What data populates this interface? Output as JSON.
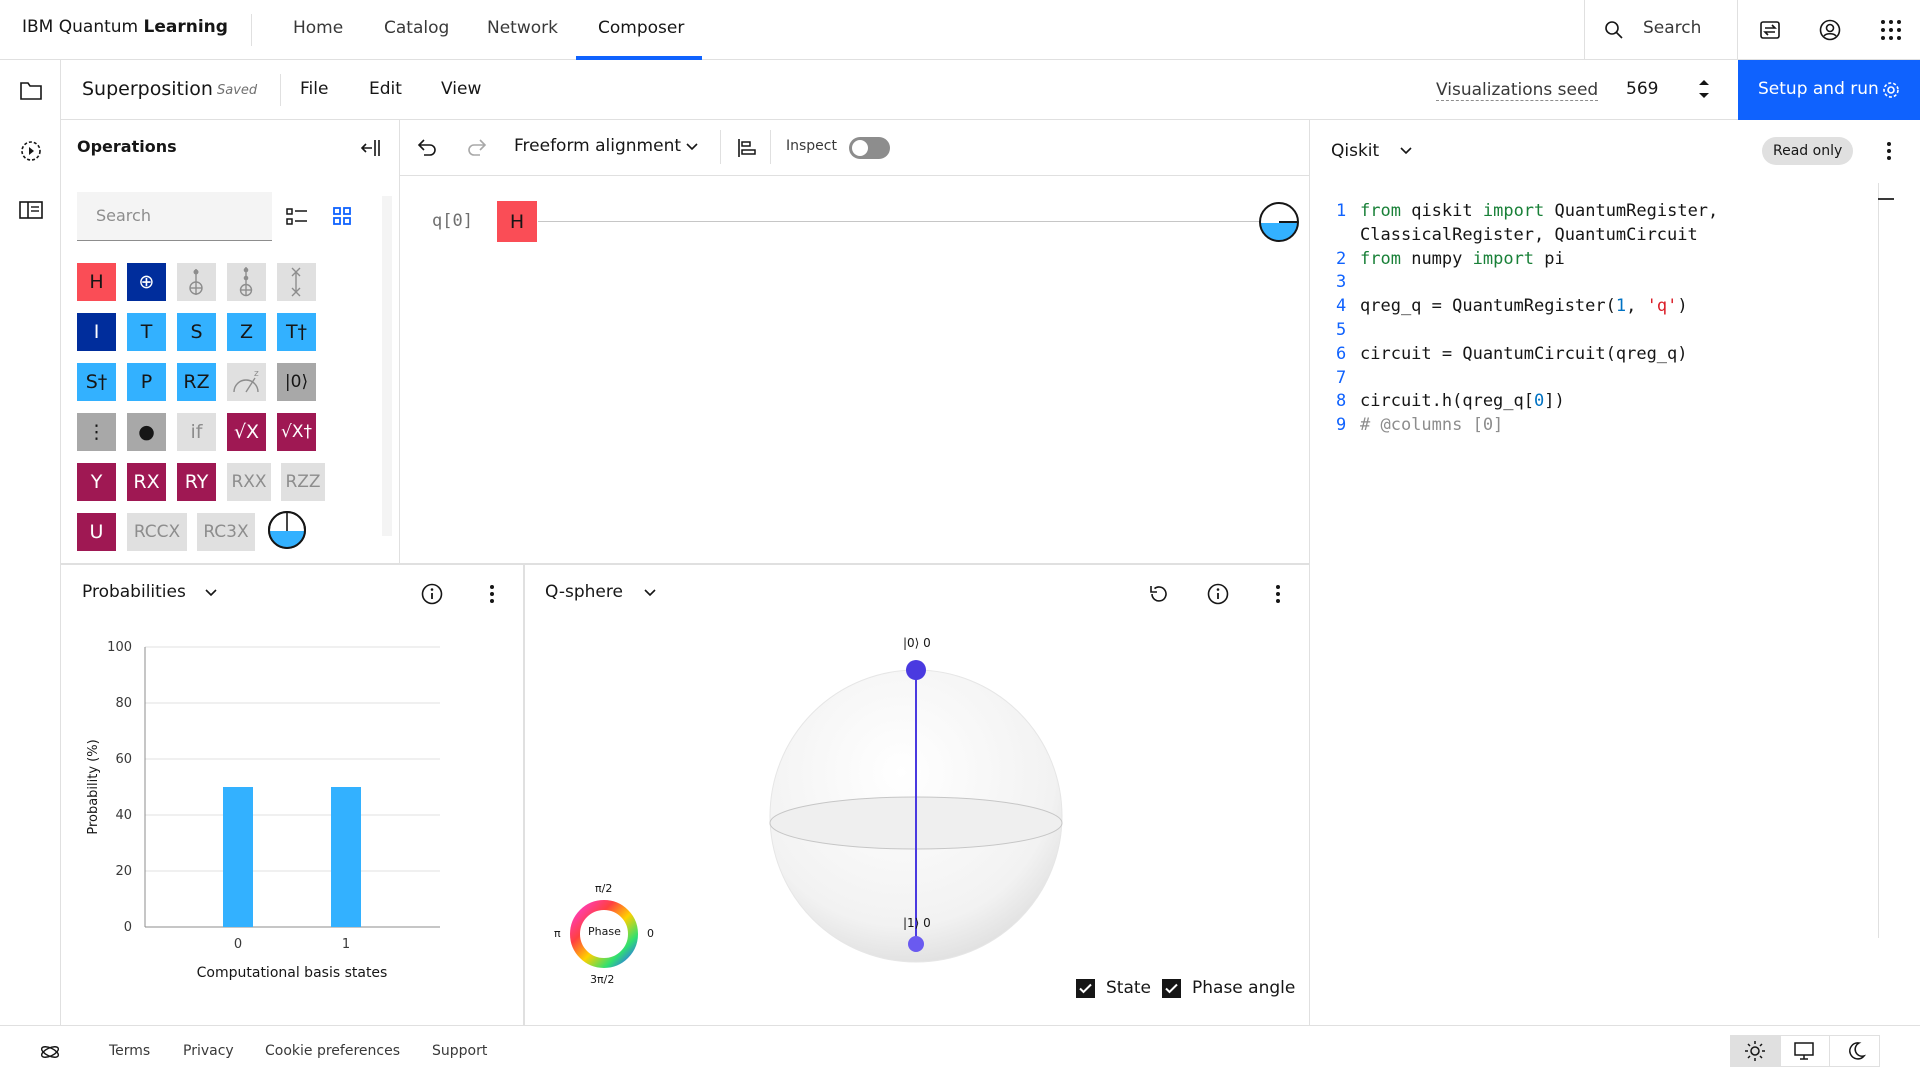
{
  "app": {
    "brand_prefix": "IBM Quantum ",
    "brand_bold": "Learning"
  },
  "nav": {
    "items": [
      "Home",
      "Catalog",
      "Network",
      "Composer"
    ],
    "active": "Composer",
    "search_label": "Search"
  },
  "subbar": {
    "circuit_name": "Superposition",
    "status": "Saved",
    "menus": [
      "File",
      "Edit",
      "View"
    ],
    "seed_label": "Visualizations seed",
    "seed_value": "569",
    "setup_label": "Setup and run"
  },
  "operations": {
    "title": "Operations",
    "search_placeholder": "Search",
    "gates": [
      [
        {
          "label": "H",
          "style": "red"
        },
        {
          "label": "⊕",
          "style": "navy"
        },
        {
          "label": "",
          "style": "gray",
          "icon": "cnot-icon"
        },
        {
          "label": "",
          "style": "gray",
          "icon": "toffoli-icon"
        },
        {
          "label": "",
          "style": "gray",
          "icon": "swap-icon"
        }
      ],
      [
        {
          "label": "I",
          "style": "navy"
        },
        {
          "label": "T",
          "style": "blue"
        },
        {
          "label": "S",
          "style": "blue"
        },
        {
          "label": "Z",
          "style": "blue"
        },
        {
          "label": "T†",
          "style": "blue"
        }
      ],
      [
        {
          "label": "S†",
          "style": "blue"
        },
        {
          "label": "P",
          "style": "blue"
        },
        {
          "label": "RZ",
          "style": "blue"
        },
        {
          "label": "",
          "style": "gray",
          "icon": "measure-icon"
        },
        {
          "label": "|0⟩",
          "style": "dgray"
        }
      ],
      [
        {
          "label": "⋮",
          "style": "dgray"
        },
        {
          "label": "●",
          "style": "dgray"
        },
        {
          "label": "if",
          "style": "gray"
        },
        {
          "label": "√X",
          "style": "mag"
        },
        {
          "label": "√X†",
          "style": "mag"
        }
      ],
      [
        {
          "label": "Y",
          "style": "mag"
        },
        {
          "label": "RX",
          "style": "mag"
        },
        {
          "label": "RY",
          "style": "mag"
        },
        {
          "label": "RXX",
          "style": "gray"
        },
        {
          "label": "RZZ",
          "style": "gray"
        }
      ],
      [
        {
          "label": "U",
          "style": "mag"
        },
        {
          "label": "RCCX",
          "style": "gray"
        },
        {
          "label": "RC3X",
          "style": "gray"
        }
      ]
    ]
  },
  "circuit": {
    "alignment": "Freeform alignment",
    "inspect_label": "Inspect",
    "inspect_on": false,
    "qubit_label": "q[0]",
    "gate": "H"
  },
  "code": {
    "language": "Qiskit",
    "read_only_label": "Read only",
    "lines": [
      {
        "n": "1",
        "parts": [
          [
            "kw",
            "from"
          ],
          [
            "",
            "qiskit "
          ],
          [
            "kw",
            "import"
          ],
          [
            "",
            " QuantumRegister,"
          ]
        ]
      },
      {
        "n": "",
        "parts": [
          [
            "",
            "ClassicalRegister, QuantumCircuit"
          ]
        ]
      },
      {
        "n": "2",
        "parts": [
          [
            "kw",
            "from"
          ],
          [
            "",
            "numpy "
          ],
          [
            "kw",
            "import"
          ],
          [
            "",
            " pi"
          ]
        ]
      },
      {
        "n": "3",
        "parts": []
      },
      {
        "n": "4",
        "parts": [
          [
            "",
            "qreg_q = QuantumRegister("
          ],
          [
            "num",
            "1"
          ],
          [
            "",
            ", "
          ],
          [
            "str",
            "'q'"
          ],
          [
            "",
            ")"
          ]
        ]
      },
      {
        "n": "5",
        "parts": []
      },
      {
        "n": "6",
        "parts": [
          [
            "",
            "circuit = QuantumCircuit(qreg_q)"
          ]
        ]
      },
      {
        "n": "7",
        "parts": []
      },
      {
        "n": "8",
        "parts": [
          [
            "",
            "circuit.h(qreg_q["
          ],
          [
            "num",
            "0"
          ],
          [
            "",
            "])"
          ]
        ]
      },
      {
        "n": "9",
        "parts": [
          [
            "cm",
            "# @columns [0]"
          ]
        ]
      }
    ]
  },
  "probabilities": {
    "title": "Probabilities",
    "chart_data": {
      "type": "bar",
      "categories": [
        "0",
        "1"
      ],
      "values": [
        50,
        50
      ],
      "xlabel": "Computational basis states",
      "ylabel": "Probability (%)",
      "ylim": [
        0,
        100
      ],
      "yticks": [
        "0",
        "20",
        "40",
        "60",
        "80",
        "100"
      ],
      "bar_color": "#33b1ff",
      "grid": true
    }
  },
  "qsphere": {
    "title": "Q-sphere",
    "top_label": "|0⟩ 0",
    "bottom_label": "|1⟩ 0",
    "phase_wheel": {
      "center": "Phase",
      "top": "π/2",
      "left": "π",
      "right": "0",
      "bottom": "3π/2"
    },
    "legend": [
      {
        "label": "State",
        "checked": true
      },
      {
        "label": "Phase angle",
        "checked": true
      }
    ],
    "state_color": "#4a3ae0"
  },
  "footer": {
    "links": [
      "Terms",
      "Privacy",
      "Cookie preferences",
      "Support"
    ],
    "theme_options": [
      "light",
      "system",
      "dark"
    ],
    "active_theme": "light"
  },
  "colors": {
    "accent": "#0f62fe",
    "gate_red": "#fa4d56",
    "gate_blue": "#33b1ff",
    "gate_navy": "#002d9c",
    "gate_magenta": "#9f1853"
  }
}
